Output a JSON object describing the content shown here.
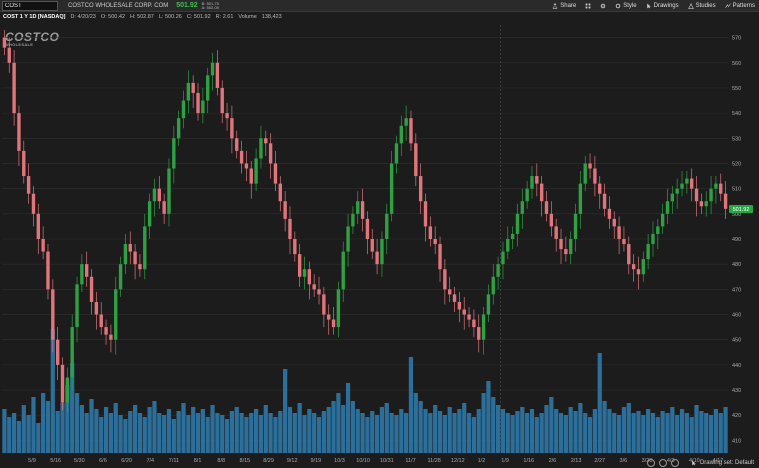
{
  "header": {
    "symbol": "COST",
    "company": "COSTCO WHOLESALE CORP. COM",
    "last_price": "501.92",
    "bid": "B: 501.75",
    "ask": "A: 502.05"
  },
  "toolbar": {
    "share": "Share",
    "style": "Style",
    "drawings": "Drawings",
    "studies": "Studies",
    "patterns": "Patterns"
  },
  "info": {
    "title": "COST 1 Y 1D [NASDAQ]",
    "date": "D: 4/20/23",
    "open": "O: 500.42",
    "high": "H: 502.87",
    "low": "L: 500.26",
    "close": "C: 501.92",
    "range": "R: 2.61",
    "volume_label": "Volume",
    "volume_value": "138,423"
  },
  "logo": {
    "main": "COSTCO",
    "sub": "WHOLESALE"
  },
  "footer": {
    "drawing_set": "Drawing set: Default"
  },
  "colors": {
    "up": "#2fa043",
    "down": "#e0757b",
    "volume": "#2b6f9a",
    "last_badge": "#27a744"
  },
  "chart_data": {
    "type": "candlestick",
    "y_ticks": [
      410,
      420,
      430,
      440,
      450,
      460,
      470,
      480,
      490,
      500,
      510,
      520,
      530,
      540,
      550,
      560,
      570
    ],
    "ylim": [
      405,
      575
    ],
    "price_badge": "501.92",
    "x_ticks": [
      "5/9",
      "5/16",
      "5/30",
      "6/6",
      "6/20",
      "7/4",
      "7/11",
      "8/1",
      "8/8",
      "8/15",
      "8/29",
      "9/12",
      "9/19",
      "10/3",
      "10/10",
      "10/31",
      "11/7",
      "11/28",
      "12/12",
      "1/2",
      "1/9",
      "1/16",
      "2/6",
      "2/13",
      "2/27",
      "3/6",
      "3/20",
      "4/3",
      "4/10",
      "4/17"
    ],
    "closes": [
      566,
      560,
      540,
      525,
      515,
      508,
      500,
      490,
      485,
      470,
      450,
      440,
      425,
      435,
      455,
      472,
      480,
      475,
      465,
      460,
      455,
      452,
      450,
      470,
      480,
      488,
      485,
      480,
      478,
      495,
      505,
      510,
      505,
      500,
      518,
      530,
      538,
      545,
      552,
      548,
      540,
      545,
      555,
      560,
      550,
      540,
      538,
      530,
      525,
      520,
      518,
      512,
      522,
      530,
      528,
      520,
      512,
      505,
      498,
      490,
      484,
      475,
      478,
      472,
      470,
      468,
      460,
      458,
      455,
      470,
      485,
      495,
      500,
      505,
      498,
      490,
      485,
      480,
      490,
      500,
      520,
      528,
      535,
      538,
      528,
      515,
      505,
      495,
      490,
      488,
      478,
      470,
      468,
      465,
      462,
      460,
      458,
      455,
      450,
      460,
      468,
      475,
      480,
      485,
      490,
      492,
      500,
      505,
      510,
      515,
      512,
      505,
      500,
      495,
      490,
      486,
      484,
      490,
      500,
      512,
      520,
      518,
      512,
      508,
      502,
      498,
      495,
      490,
      488,
      480,
      478,
      476,
      482,
      488,
      492,
      495,
      500,
      505,
      508,
      510,
      512,
      514,
      510,
      505,
      503,
      505,
      510,
      512,
      508,
      502
    ],
    "volumes": [
      0.22,
      0.18,
      0.2,
      0.16,
      0.24,
      0.19,
      0.28,
      0.15,
      0.3,
      0.26,
      0.62,
      0.21,
      0.25,
      0.34,
      0.45,
      0.3,
      0.24,
      0.2,
      0.27,
      0.22,
      0.18,
      0.23,
      0.2,
      0.25,
      0.19,
      0.17,
      0.21,
      0.24,
      0.2,
      0.18,
      0.23,
      0.26,
      0.2,
      0.19,
      0.22,
      0.17,
      0.21,
      0.25,
      0.19,
      0.23,
      0.2,
      0.22,
      0.18,
      0.24,
      0.2,
      0.19,
      0.17,
      0.21,
      0.23,
      0.2,
      0.18,
      0.2,
      0.22,
      0.19,
      0.24,
      0.2,
      0.18,
      0.21,
      0.42,
      0.23,
      0.2,
      0.25,
      0.19,
      0.22,
      0.2,
      0.18,
      0.21,
      0.23,
      0.26,
      0.3,
      0.24,
      0.35,
      0.26,
      0.22,
      0.2,
      0.18,
      0.21,
      0.19,
      0.23,
      0.25,
      0.2,
      0.19,
      0.22,
      0.2,
      0.48,
      0.3,
      0.26,
      0.22,
      0.2,
      0.24,
      0.21,
      0.19,
      0.23,
      0.2,
      0.22,
      0.25,
      0.2,
      0.18,
      0.22,
      0.3,
      0.36,
      0.28,
      0.24,
      0.22,
      0.2,
      0.19,
      0.21,
      0.23,
      0.2,
      0.22,
      0.18,
      0.2,
      0.24,
      0.28,
      0.22,
      0.2,
      0.19,
      0.23,
      0.21,
      0.25,
      0.2,
      0.18,
      0.22,
      0.5,
      0.26,
      0.22,
      0.2,
      0.19,
      0.23,
      0.25,
      0.2,
      0.21,
      0.19,
      0.22,
      0.2,
      0.18,
      0.21,
      0.2,
      0.23,
      0.19,
      0.22,
      0.2,
      0.18,
      0.24,
      0.21,
      0.2,
      0.19,
      0.22,
      0.2,
      0.23
    ]
  }
}
